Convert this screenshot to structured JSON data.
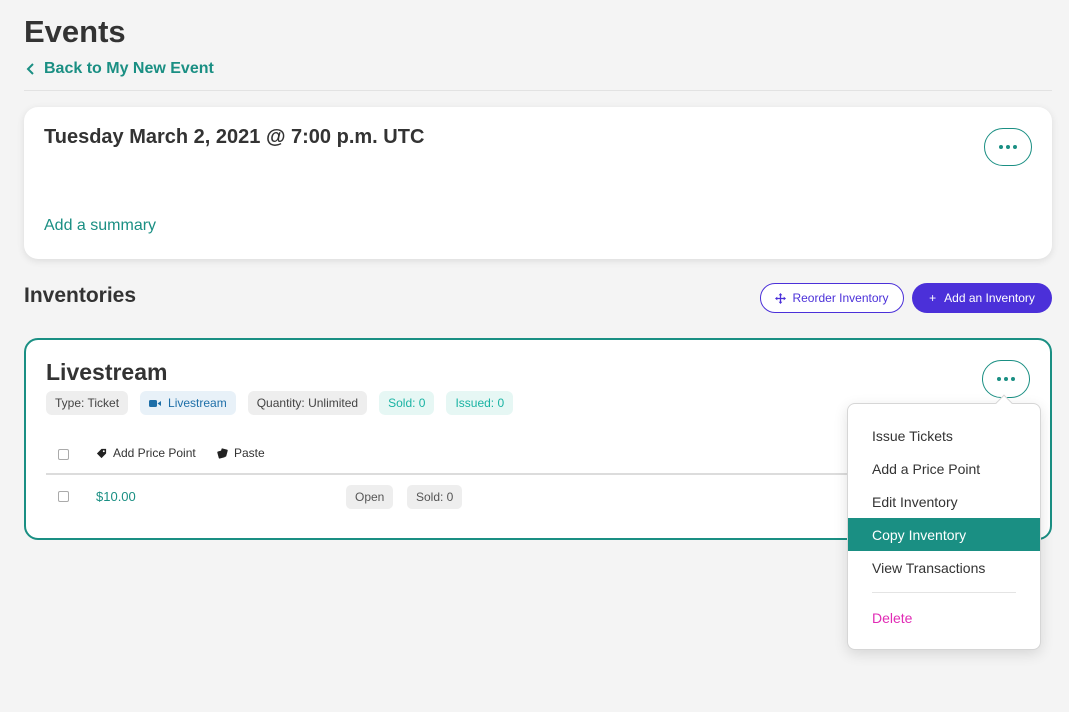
{
  "page": {
    "title": "Events"
  },
  "back": {
    "label": "Back to My New Event"
  },
  "event": {
    "date_title": "Tuesday March 2, 2021 @ 7:00 p.m. UTC",
    "summary_link": "Add a summary"
  },
  "inventories": {
    "section_title": "Inventories",
    "reorder_label": "Reorder Inventory",
    "add_label": "Add an Inventory",
    "add_icon": "+"
  },
  "inventory": {
    "title": "Livestream",
    "chips": {
      "type": "Type: Ticket",
      "format": "Livestream",
      "quantity": "Quantity: Unlimited",
      "sold": "Sold: 0",
      "issued": "Issued: 0"
    },
    "toolbar": {
      "add_price_point": "Add Price Point",
      "paste": "Paste"
    },
    "rows": [
      {
        "price": "$10.00",
        "status": "Open",
        "sold": "Sold: 0"
      }
    ]
  },
  "menu": {
    "items": [
      "Issue Tickets",
      "Add a Price Point",
      "Edit Inventory",
      "Copy Inventory",
      "View Transactions"
    ],
    "active_item": "Copy Inventory",
    "delete_label": "Delete"
  },
  "colors": {
    "teal": "#1a8f83",
    "purple": "#4b30d9",
    "magenta": "#e12bb5",
    "background": "#f4f4f4"
  }
}
